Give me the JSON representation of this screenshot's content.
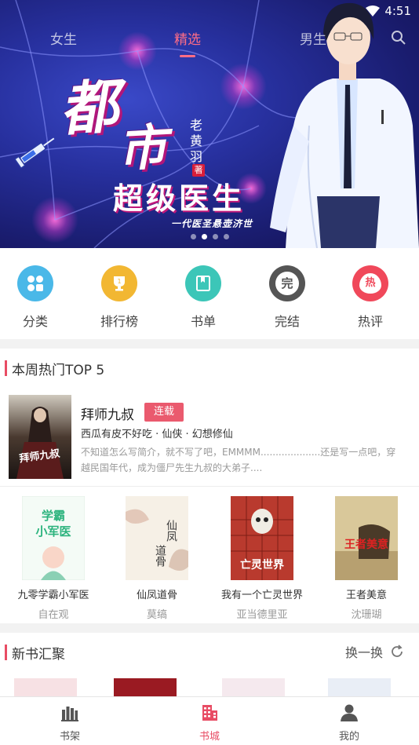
{
  "status": {
    "time": "4:51"
  },
  "top_tabs": [
    {
      "label": "女生",
      "active": false
    },
    {
      "label": "精选",
      "active": true
    },
    {
      "label": "男生",
      "active": false
    }
  ],
  "banner": {
    "title_line1": "都",
    "title_line1b": "市",
    "subtitle": "超级医生",
    "author": "老黄羽",
    "author_mark": "著",
    "slogan": "一代医圣悬壶济世",
    "carousel_count": 4,
    "carousel_active": 1
  },
  "categories": [
    {
      "label": "分类",
      "icon": "grid-icon",
      "color": "#4ab8e8"
    },
    {
      "label": "排行榜",
      "icon": "trophy-icon",
      "color": "#f2b732"
    },
    {
      "label": "书单",
      "icon": "booklist-icon",
      "color": "#3cc6b8"
    },
    {
      "label": "完结",
      "icon": "finished-icon",
      "color": "#555555",
      "glyph": "完"
    },
    {
      "label": "热评",
      "icon": "hot-review-icon",
      "color": "#f0485a",
      "glyph": "热"
    }
  ],
  "hot_section": {
    "title": "本周热门TOP 5",
    "featured": {
      "title": "拜师九叔",
      "badge": "连载",
      "meta": "西瓜有皮不好吃 · 仙侠 · 幻想修仙",
      "description": "不知道怎么写简介，就不写了吧，EMMMM....................还是写一点吧，穿越民国年代，成为僵尸先生九叔的大弟子....",
      "cover_text": "拜师九叔"
    },
    "books": [
      {
        "name": "九零学霸小军医",
        "author": "自在观",
        "cover_text": "学霸小军医"
      },
      {
        "name": "仙凤道骨",
        "author": "莫缟",
        "cover_text": "仙凤道骨"
      },
      {
        "name": "我有一个亡灵世界",
        "author": "亚当德里亚",
        "cover_text": "亡灵世界"
      },
      {
        "name": "王者美意",
        "author": "沈珊瑚",
        "cover_text": "王者美意"
      }
    ]
  },
  "new_books": {
    "title": "新书汇聚",
    "refresh_label": "换一换"
  },
  "bottom_nav": [
    {
      "label": "书架",
      "icon": "bookshelf-icon",
      "active": false
    },
    {
      "label": "书城",
      "icon": "bookstore-icon",
      "active": true
    },
    {
      "label": "我的",
      "icon": "profile-icon",
      "active": false
    }
  ],
  "colors": {
    "accent": "#e84c64",
    "banner_bg": "#27309e"
  }
}
